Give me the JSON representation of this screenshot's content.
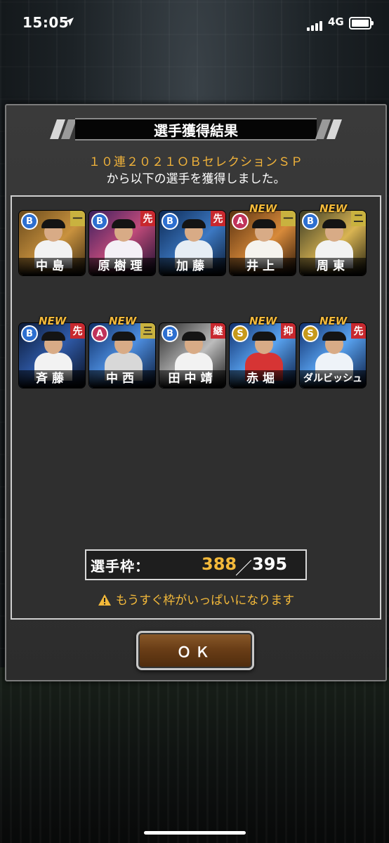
{
  "status_bar": {
    "time": "15:05",
    "network": "4G"
  },
  "dialog": {
    "title": "選手獲得結果",
    "gacha_name": "１０連２０２１ＯＢセレクションＳＰ",
    "message": "から以下の選手を獲得しました。",
    "new_label": "NEW",
    "players": [
      {
        "name": "中島",
        "rank": "B",
        "position": "一",
        "is_new": false
      },
      {
        "name": "原樹理",
        "rank": "B",
        "position": "先",
        "is_new": false
      },
      {
        "name": "加藤",
        "rank": "B",
        "position": "先",
        "is_new": false
      },
      {
        "name": "井上",
        "rank": "A",
        "position": "一",
        "is_new": true
      },
      {
        "name": "周東",
        "rank": "B",
        "position": "二",
        "is_new": true
      },
      {
        "name": "斉藤",
        "rank": "B",
        "position": "先",
        "is_new": true
      },
      {
        "name": "中西",
        "rank": "A",
        "position": "三",
        "is_new": true
      },
      {
        "name": "田中靖",
        "rank": "B",
        "position": "継",
        "is_new": false
      },
      {
        "name": "赤堀",
        "rank": "S",
        "position": "抑",
        "is_new": true
      },
      {
        "name": "ダルビッシュ",
        "rank": "S",
        "position": "先",
        "is_new": true
      }
    ],
    "roster_label": "選手枠：",
    "roster_current": "388",
    "roster_separator": "／",
    "roster_max": "395",
    "warning": "もうすぐ枠がいっぱいになります",
    "ok_label": "ＯＫ"
  },
  "colors": {
    "accent_gold": "#f3b93a",
    "rank_B": "#2d6fd0",
    "rank_A": "#c0335a",
    "rank_S": "#c79a1c"
  }
}
